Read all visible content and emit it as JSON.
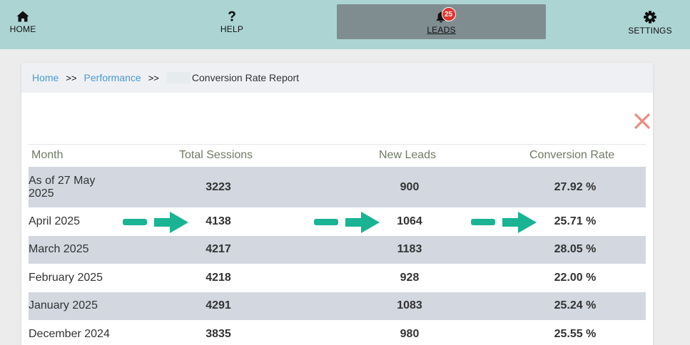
{
  "nav": {
    "home_label": "HOME",
    "help_label": "HELP",
    "leads_label": "LEADS",
    "leads_badge": "25",
    "settings_label": "SETTINGS"
  },
  "breadcrumb": {
    "home": "Home",
    "performance": "Performance",
    "separator": ">>",
    "current": "Conversion Rate Report"
  },
  "table": {
    "headers": {
      "month": "Month",
      "sessions": "Total Sessions",
      "leads": "New Leads",
      "rate": "Conversion Rate"
    },
    "rows": [
      {
        "month": "As of 27 May 2025",
        "sessions": "3223",
        "leads": "900",
        "rate": "27.92 %"
      },
      {
        "month": "April 2025",
        "sessions": "4138",
        "leads": "1064",
        "rate": "25.71 %"
      },
      {
        "month": "March 2025",
        "sessions": "4217",
        "leads": "1183",
        "rate": "28.05 %"
      },
      {
        "month": "February 2025",
        "sessions": "4218",
        "leads": "928",
        "rate": "22.00 %"
      },
      {
        "month": "January 2025",
        "sessions": "4291",
        "leads": "1083",
        "rate": "25.24 %"
      },
      {
        "month": "December 2024",
        "sessions": "3835",
        "leads": "980",
        "rate": "25.55 %"
      }
    ]
  },
  "colors": {
    "nav_bg": "#acd4d3",
    "leads_active_bg": "#7f8d91",
    "badge": "#e0352f",
    "link": "#4a9ad4",
    "row_shade": "#d2d7e0",
    "arrow": "#1ab394",
    "close": "#f08a80"
  },
  "icons": [
    "home-icon",
    "question-icon",
    "bell-icon",
    "gear-icon",
    "close-icon",
    "arrow-right-icon"
  ]
}
